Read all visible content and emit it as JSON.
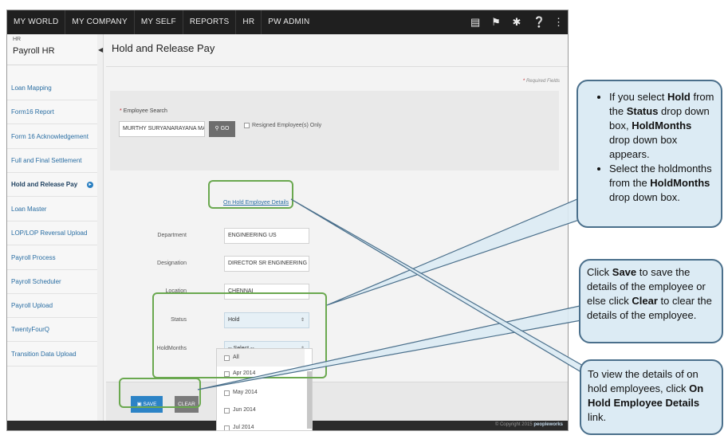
{
  "topnav": {
    "items": [
      "MY WORLD",
      "MY COMPANY",
      "MY SELF",
      "REPORTS",
      "HR",
      "PW ADMIN"
    ],
    "icons": [
      "book-icon",
      "flag-icon",
      "tools-icon",
      "help-icon",
      "share-icon"
    ]
  },
  "sidebar": {
    "module_small": "HR",
    "module_title": "Payroll HR",
    "items": [
      "Loan Mapping",
      "Form16 Report",
      "Form 16 Acknowledgement",
      "Full and Final Settlement",
      "Hold and Release Pay",
      "Loan Master",
      "LOP/LOP Reversal Upload",
      "Payroll Process",
      "Payroll Scheduler",
      "Payroll Upload",
      "TwentyFourQ",
      "Transition Data Upload"
    ],
    "active_index": 4
  },
  "page": {
    "title": "Hold and Release Pay",
    "required_note": "Required Fields",
    "employee_search_label": "Employee Search",
    "employee_search_value": "MURTHY SURYANARAYANA MAN",
    "go_label": "GO",
    "resigned_label": "Resigned Employee(s) Only",
    "on_hold_link": "On Hold Employee Details"
  },
  "form": {
    "department_label": "Department",
    "department_value": "ENGINEERING US",
    "designation_label": "Designation",
    "designation_value": "DIRECTOR SR ENGINEERING",
    "location_label": "Location",
    "location_value": "CHENNAI",
    "status_label": "Status",
    "status_value": "Hold",
    "holdmonths_label": "HoldMonths",
    "holdmonths_value": "-- Select --"
  },
  "holdmonths_options": [
    "All",
    "Apr 2014",
    "May 2014",
    "Jun 2014",
    "Jul 2014"
  ],
  "actions": {
    "save_label": "SAVE",
    "clear_label": "CLEAR"
  },
  "footer": {
    "copyright": "© Copyright 2015",
    "brand": "peopleworks"
  },
  "callouts": {
    "c1_b1_p1": "If you select ",
    "c1_b1_b1": "Hold",
    "c1_b1_p2": " from the ",
    "c1_b1_b2": "Status",
    "c1_b1_p3": " drop down box, ",
    "c1_b1_b3": "HoldMonths",
    "c1_b1_p4": " drop down box appears.",
    "c1_b2_p1": "Select the holdmonths from the ",
    "c1_b2_b1": "HoldMonths",
    "c1_b2_p2": " drop down box.",
    "c2_p1": "Click ",
    "c2_b1": "Save",
    "c2_p2": " to save the details of the employee or else click ",
    "c2_b2": "Clear",
    "c2_p3": " to clear the details of the employee.",
    "c3_p1": "To view the details of on hold employees, click ",
    "c3_b1": "On Hold Employee Details",
    "c3_p2": " link."
  },
  "colors": {
    "highlight": "#6aa84f",
    "callout_fill": "#dcebf4",
    "callout_border": "#4a6f8b",
    "primary_button": "#2c83c6"
  }
}
